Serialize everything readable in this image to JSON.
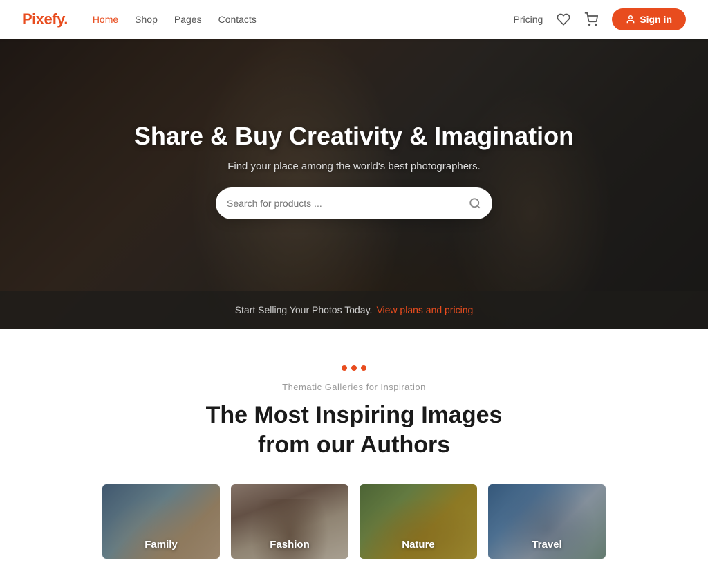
{
  "brand": {
    "name": "Pixefy",
    "dot": "."
  },
  "nav": {
    "items": [
      {
        "label": "Home",
        "active": true
      },
      {
        "label": "Shop",
        "active": false
      },
      {
        "label": "Pages",
        "active": false
      },
      {
        "label": "Contacts",
        "active": false
      }
    ],
    "pricing": "Pricing",
    "signin": "Sign in"
  },
  "hero": {
    "title": "Share & Buy Creativity & Imagination",
    "subtitle": "Find your place among the world's best photographers.",
    "search_placeholder": "Search for products ...",
    "cta_text": "Start Selling Your Photos Today.",
    "cta_link": "View plans and pricing"
  },
  "galleries": {
    "dots": [
      "●",
      "●",
      "●"
    ],
    "label": "Thematic Galleries for Inspiration",
    "title": "The Most Inspiring Images\nfrom our Authors",
    "cards": [
      {
        "id": "family",
        "label": "Family"
      },
      {
        "id": "fashion",
        "label": "Fashion"
      },
      {
        "id": "nature",
        "label": "Nature"
      },
      {
        "id": "travel",
        "label": "Travel"
      }
    ]
  }
}
